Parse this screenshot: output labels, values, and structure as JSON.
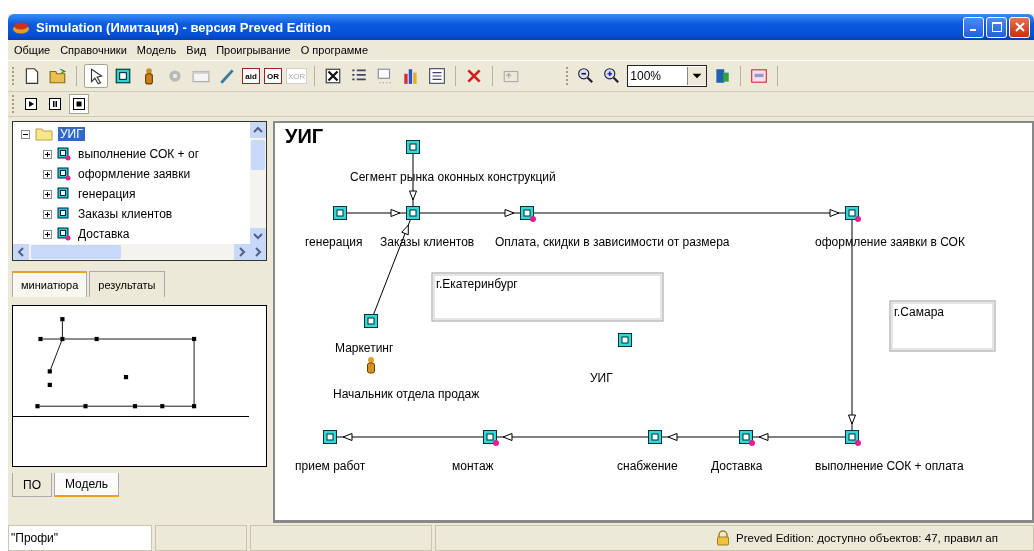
{
  "window": {
    "title": "Simulation (Имитация) - версия Preved Edition"
  },
  "menu": [
    "Общие",
    "Справочники",
    "Модель",
    "Вид",
    "Проигрывание",
    "О программе"
  ],
  "toolbar": {
    "gate_buttons": [
      {
        "label": "aid",
        "disabled": false
      },
      {
        "label": "OR",
        "disabled": false
      },
      {
        "label": "XOR",
        "disabled": true
      }
    ],
    "zoom": "100%"
  },
  "playback": [
    {
      "kind": "play",
      "selected": false
    },
    {
      "kind": "pause",
      "selected": false
    },
    {
      "kind": "stop",
      "selected": true
    }
  ],
  "tree": {
    "label": "УИГ",
    "expanded": true,
    "selected": true,
    "children": [
      {
        "label": "выполнение СОК + ог",
        "expanded": false,
        "marked": true
      },
      {
        "label": "оформление  заявки",
        "expanded": false,
        "marked": true
      },
      {
        "label": "генерация",
        "expanded": false,
        "marked": false
      },
      {
        "label": "Заказы клиентов",
        "expanded": false,
        "marked": false
      },
      {
        "label": "Доставка",
        "expanded": false,
        "marked": true
      }
    ]
  },
  "view_tabs": [
    {
      "label": "миниатюра",
      "selected": true
    },
    {
      "label": "результаты",
      "selected": false
    }
  ],
  "bottom_tabs": [
    {
      "label": "ПО",
      "selected": false
    },
    {
      "label": "Модель",
      "selected": true
    }
  ],
  "diagram": {
    "title": "УИГ",
    "nodes": [
      {
        "kind": "process",
        "label": "Сегмент рынка оконных конструкций",
        "marked": false
      },
      {
        "kind": "process",
        "label": "генерация",
        "marked": false
      },
      {
        "kind": "process",
        "label": "Заказы клиентов",
        "marked": false
      },
      {
        "kind": "process",
        "label": "Оплата,  скидки  в зависимости  от размера",
        "marked": true
      },
      {
        "kind": "process",
        "label": "оформление  заявки в  СОК",
        "marked": true
      },
      {
        "kind": "process",
        "label": "Маркетинг",
        "marked": false
      },
      {
        "kind": "person",
        "label": "Начальник отдела продаж"
      },
      {
        "kind": "process",
        "label": "УИГ",
        "marked": false
      },
      {
        "kind": "process",
        "label": "прием работ",
        "marked": false
      },
      {
        "kind": "process",
        "label": "монтаж",
        "marked": true
      },
      {
        "kind": "process",
        "label": "снабжение",
        "marked": false
      },
      {
        "kind": "process",
        "label": "Доставка",
        "marked": true
      },
      {
        "kind": "process",
        "label": "выполнение СОК + оплата",
        "marked": true
      }
    ],
    "notes": [
      "г.Екатеринбург",
      "г.Самара"
    ]
  },
  "status_bar": {
    "mode": "\"Профи\"",
    "message": "Preved Edition: доступно объектов: 47, правил ап"
  }
}
